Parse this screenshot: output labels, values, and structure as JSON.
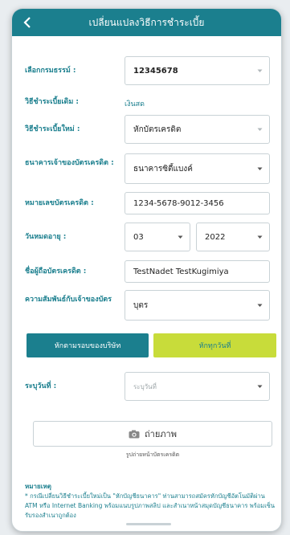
{
  "header": {
    "title": "เปลี่ยนแปลงวิธีการชำระเบี้ย"
  },
  "form": {
    "policy": {
      "label": "เลือกกรมธรรม์ :",
      "value": "12345678"
    },
    "current_method": {
      "label": "วิธีชำระเบี้ยเดิม :",
      "value": "เงินสด"
    },
    "new_method": {
      "label": "วิธีชำระเบี้ยใหม่ :",
      "value": "หักบัตรเครดิต"
    },
    "issuing_bank": {
      "label": "ธนาคารเจ้าของบัตรเครดิต :",
      "value": "ธนาคารซิตี้แบงค์"
    },
    "card_number": {
      "label": "หมายเลขบัตรเครดิต :",
      "value": "1234-5678-9012-3456"
    },
    "expiry": {
      "label": "วันหมดอายุ :",
      "month": "03",
      "year": "2022"
    },
    "card_name": {
      "label": "ชื่อผู้ถือบัตรเครดิต :",
      "value": "TestNadet TestKugimiya"
    },
    "relationship": {
      "label": "ความสัมพันธ์กับเจ้าของบัตร",
      "value": "บุตร"
    },
    "date": {
      "label": "ระบุวันที่ :",
      "placeholder": "ระบุวันที่"
    }
  },
  "buttons": {
    "by_company_cycle": "หักตามรอบของบริษัท",
    "deduct_now": "หักทุกวันที่"
  },
  "photo": {
    "label": "ถ่ายภาพ",
    "caption": "รูปถ่ายหน้าบัตรเครดิต"
  },
  "note": {
    "title": "หมายเหตุ",
    "text": "* กรณีเปลี่ยนวิธีชำระเบี้ยใหม่เป็น \"หักบัญชีธนาคาร\" ท่านสามารถสมัครหักบัญชีอัตโนมัติผ่าน ATM หรือ Internet Banking พร้อมแนบรูปภาพสลิป และสำเนาหน้าสมุดบัญชีธนาคาร พร้อมเซ็นรับรองสำเนาถูกต้อง"
  },
  "colors": {
    "primary": "#1b7f8e",
    "accent": "#c8dc3a"
  }
}
